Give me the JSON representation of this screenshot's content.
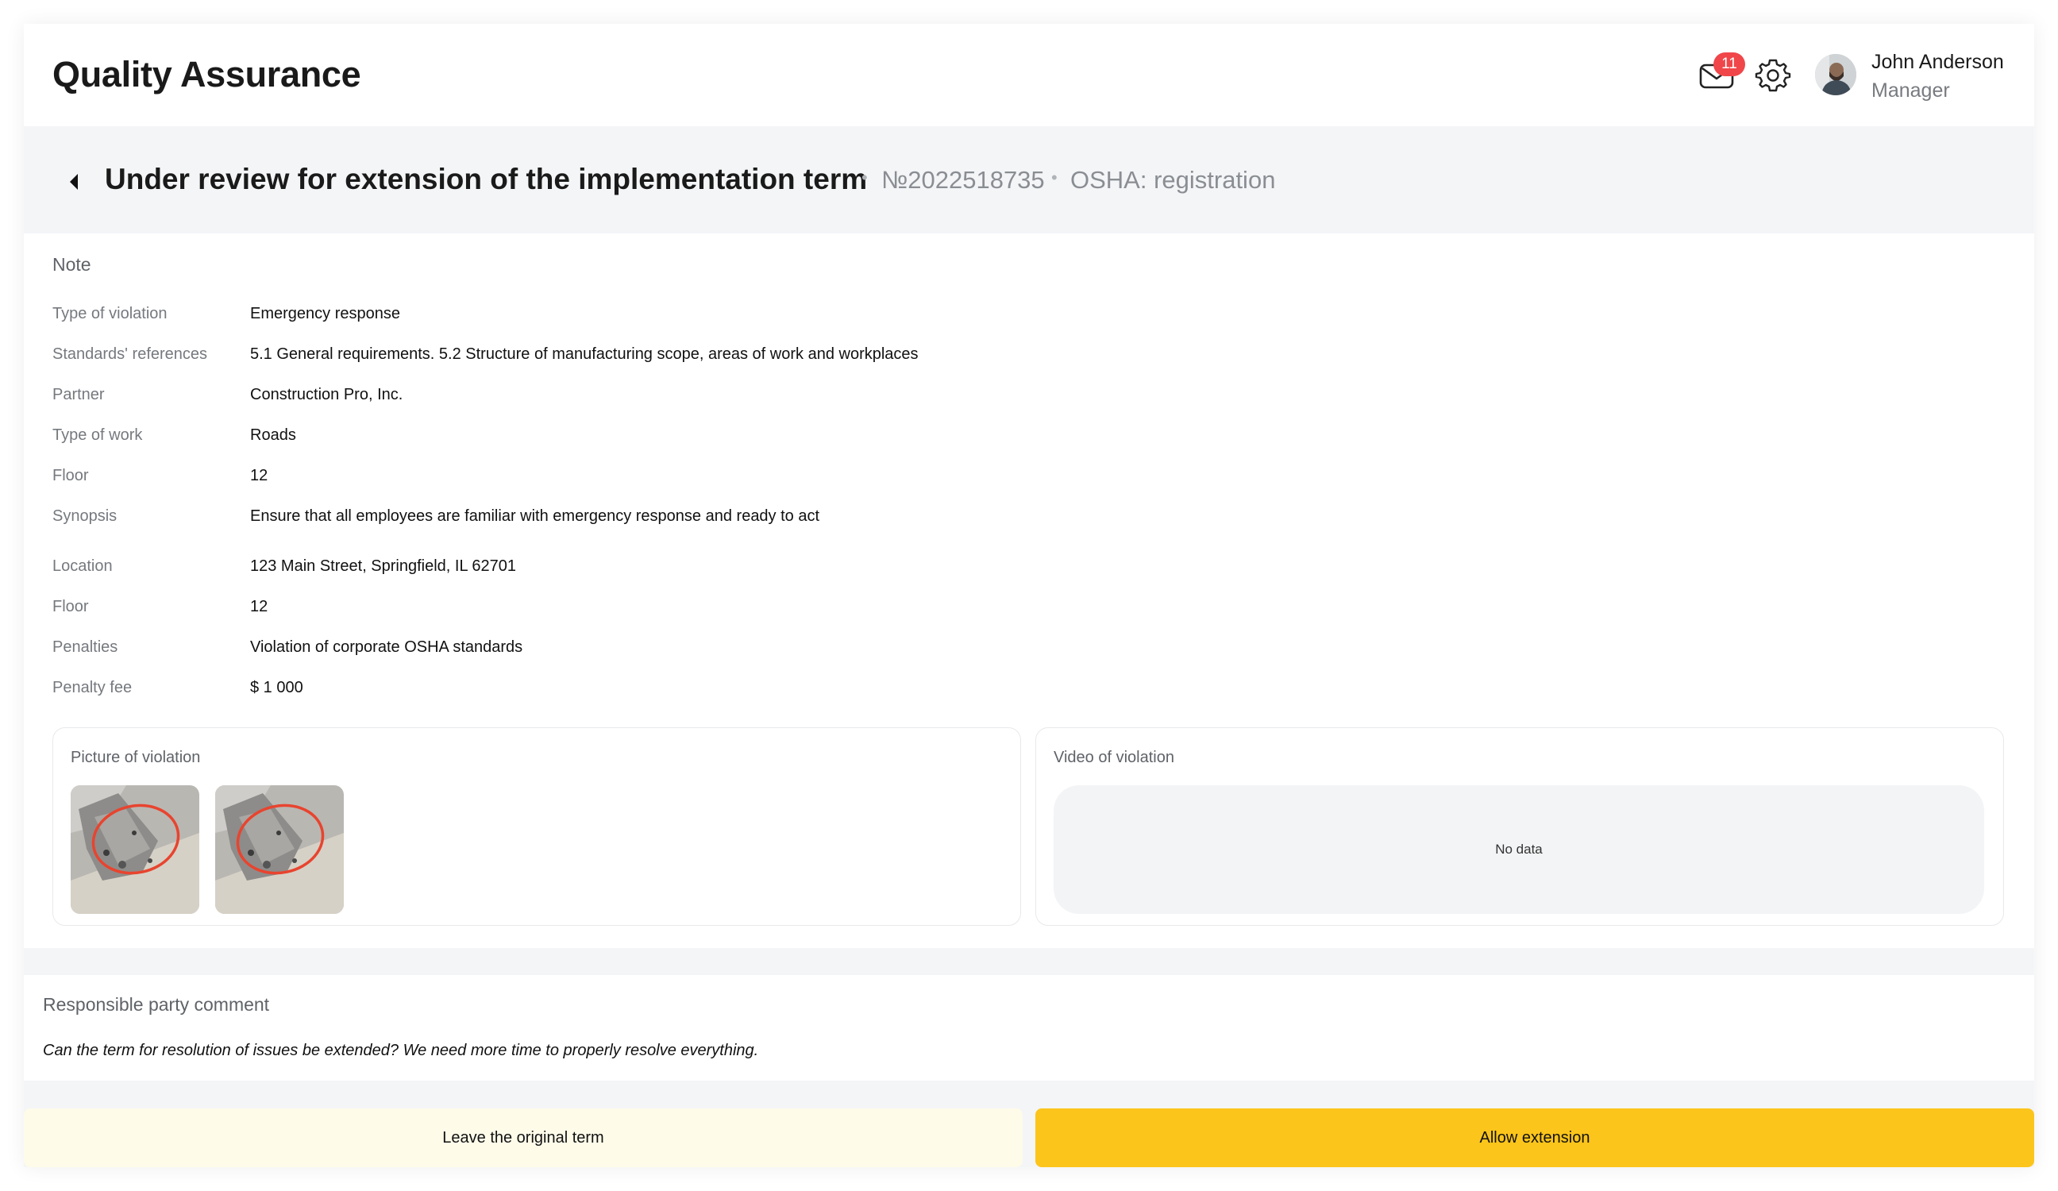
{
  "header": {
    "app_title": "Quality Assurance",
    "notifications_count": "11",
    "user": {
      "name": "John Anderson",
      "role": "Manager"
    }
  },
  "subheader": {
    "title": "Under review for extension of the implementation term",
    "number": "№2022518735",
    "category": "OSHA: registration"
  },
  "note": {
    "title": "Note",
    "rows": [
      {
        "label": "Type of violation",
        "value": "Emergency response"
      },
      {
        "label": "Standards' references",
        "value": "5.1 General requirements. 5.2 Structure of manufacturing scope, areas of work and workplaces"
      },
      {
        "label": "Partner",
        "value": "Construction Pro, Inc."
      },
      {
        "label": "Type of work",
        "value": "Roads"
      },
      {
        "label": "Floor",
        "value": "12"
      },
      {
        "label": "Synopsis",
        "value": "Ensure that all employees are familiar with emergency response and ready to act"
      },
      {
        "label": "Location",
        "value": "123 Main Street, Springfield, IL 62701"
      },
      {
        "label": "Floor",
        "value": "12"
      },
      {
        "label": "Penalties",
        "value": "Violation of corporate OSHA standards"
      },
      {
        "label": "Penalty fee",
        "value": "$ 1 000"
      }
    ]
  },
  "media": {
    "picture_title": "Picture of violation",
    "video_title": "Video of violation",
    "video_empty": "No data"
  },
  "comment": {
    "title": "Responsible party comment",
    "text": "Can the term for resolution of issues be extended? We need more time to properly resolve everything."
  },
  "actions": {
    "leave_label": "Leave the original term",
    "allow_label": "Allow extension"
  },
  "colors": {
    "primary_button": "#fcc51b",
    "secondary_button": "#fefbe9",
    "badge": "#f0464a"
  },
  "icons": [
    "mail-icon",
    "gear-icon",
    "back-arrow-icon"
  ]
}
